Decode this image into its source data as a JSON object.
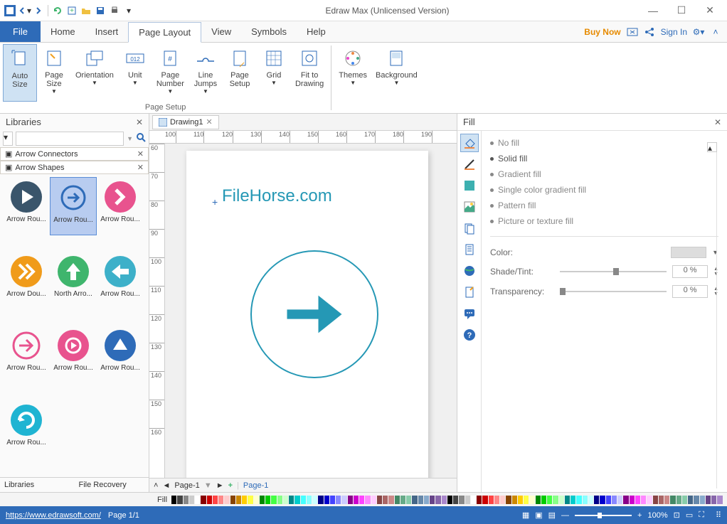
{
  "app": {
    "title": "Edraw Max (Unlicensed Version)"
  },
  "menu": {
    "file": "File",
    "items": [
      "Home",
      "Insert",
      "Page Layout",
      "View",
      "Symbols",
      "Help"
    ],
    "active": "Page Layout",
    "buyNow": "Buy Now",
    "signIn": "Sign In"
  },
  "ribbon": {
    "group1": {
      "label": "Page Setup",
      "auto_size": "Auto\nSize",
      "page_size": "Page\nSize",
      "orientation": "Orientation",
      "unit": "Unit",
      "page_number": "Page\nNumber",
      "line_jumps": "Line\nJumps",
      "page_setup": "Page\nSetup",
      "grid": "Grid",
      "fit_drawing": "Fit to\nDrawing"
    },
    "group2": {
      "themes": "Themes",
      "background": "Background"
    }
  },
  "libraries": {
    "title": "Libraries",
    "section1": "Arrow Connectors",
    "section2": "Arrow Shapes",
    "shapes": [
      {
        "label": "Arrow Rou...",
        "bg": "#3a556b",
        "type": "play"
      },
      {
        "label": "Arrow Rou...",
        "bg": "#d9e4f2",
        "type": "arrow-line",
        "selected": true
      },
      {
        "label": "Arrow Rou...",
        "bg": "#e8538e",
        "type": "chevron"
      },
      {
        "label": "Arrow Dou...",
        "bg": "#f09b1a",
        "type": "double-chevron"
      },
      {
        "label": "North Arro...",
        "bg": "#3fb56d",
        "type": "arrow-up"
      },
      {
        "label": "Arrow Rou...",
        "bg": "#3db0c9",
        "type": "arrow-left"
      },
      {
        "label": "Arrow Rou...",
        "bg": "#ffffff",
        "type": "arrow-right-outline",
        "stroke": "#e8538e"
      },
      {
        "label": "Arrow Rou...",
        "bg": "#e8538e",
        "type": "play-outline"
      },
      {
        "label": "Arrow Rou...",
        "bg": "#2e6bb8",
        "type": "triangle-up"
      },
      {
        "label": "Arrow Rou...",
        "bg": "#1fb4d2",
        "type": "refresh"
      }
    ],
    "bottom_tabs": [
      "Libraries",
      "File Recovery"
    ]
  },
  "doc": {
    "tab": "Drawing1"
  },
  "canvas": {
    "text": "FileHorse.com"
  },
  "fill": {
    "title": "Fill",
    "options": [
      "No fill",
      "Solid fill",
      "Gradient fill",
      "Single color gradient fill",
      "Pattern fill",
      "Picture or texture fill"
    ],
    "selected": "Solid fill",
    "color_label": "Color:",
    "shade_label": "Shade/Tint:",
    "trans_label": "Transparency:",
    "shade_val": "0 %",
    "trans_val": "0 %"
  },
  "footer": {
    "fill_label": "Fill",
    "page_dd": "Page-1",
    "page_tab": "Page-1"
  },
  "status": {
    "url": "https://www.edrawsoft.com/",
    "page": "Page 1/1",
    "zoom": "100%"
  },
  "ruler_h": [
    100,
    110,
    120,
    130,
    140,
    150,
    160,
    170,
    180,
    190
  ],
  "ruler_v": [
    60,
    70,
    80,
    90,
    100,
    110,
    120,
    130,
    140,
    150,
    160
  ]
}
